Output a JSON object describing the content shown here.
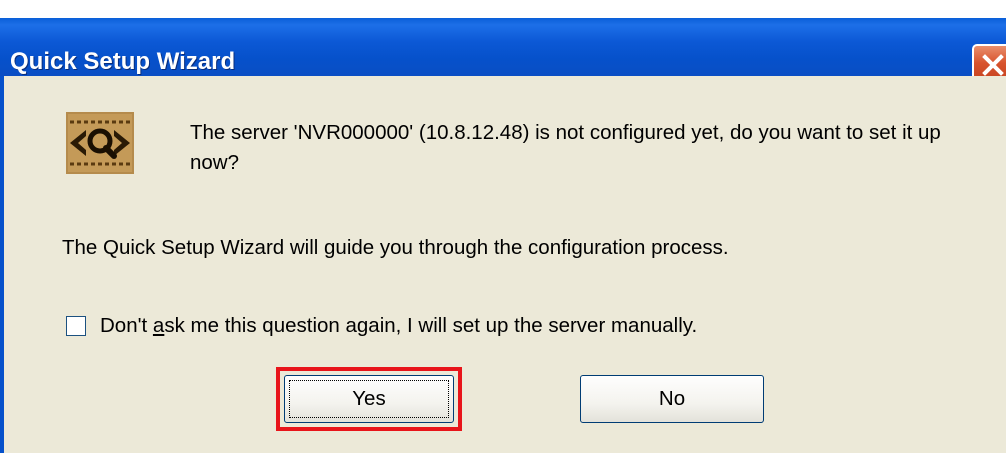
{
  "window": {
    "title": "Quick Setup Wizard"
  },
  "icons": {
    "app_icon": "eye-magnifier-icon",
    "close_icon": "close-icon"
  },
  "dialog": {
    "message": "The server 'NVR000000' (10.8.12.48) is not configured yet, do you want to set it up now?",
    "guide": "The Quick Setup Wizard will guide you through the configuration process.",
    "checkbox": {
      "label_before": "Don't ",
      "label_accel": "a",
      "label_after": "sk me this question again, I will set up the server manually.",
      "checked": false
    }
  },
  "buttons": {
    "yes": "Yes",
    "no": "No"
  },
  "colors": {
    "titlebar": "#0651cb",
    "dialog_bg": "#ece9d8",
    "highlight": "#e8141a",
    "close": "#d8532d"
  }
}
